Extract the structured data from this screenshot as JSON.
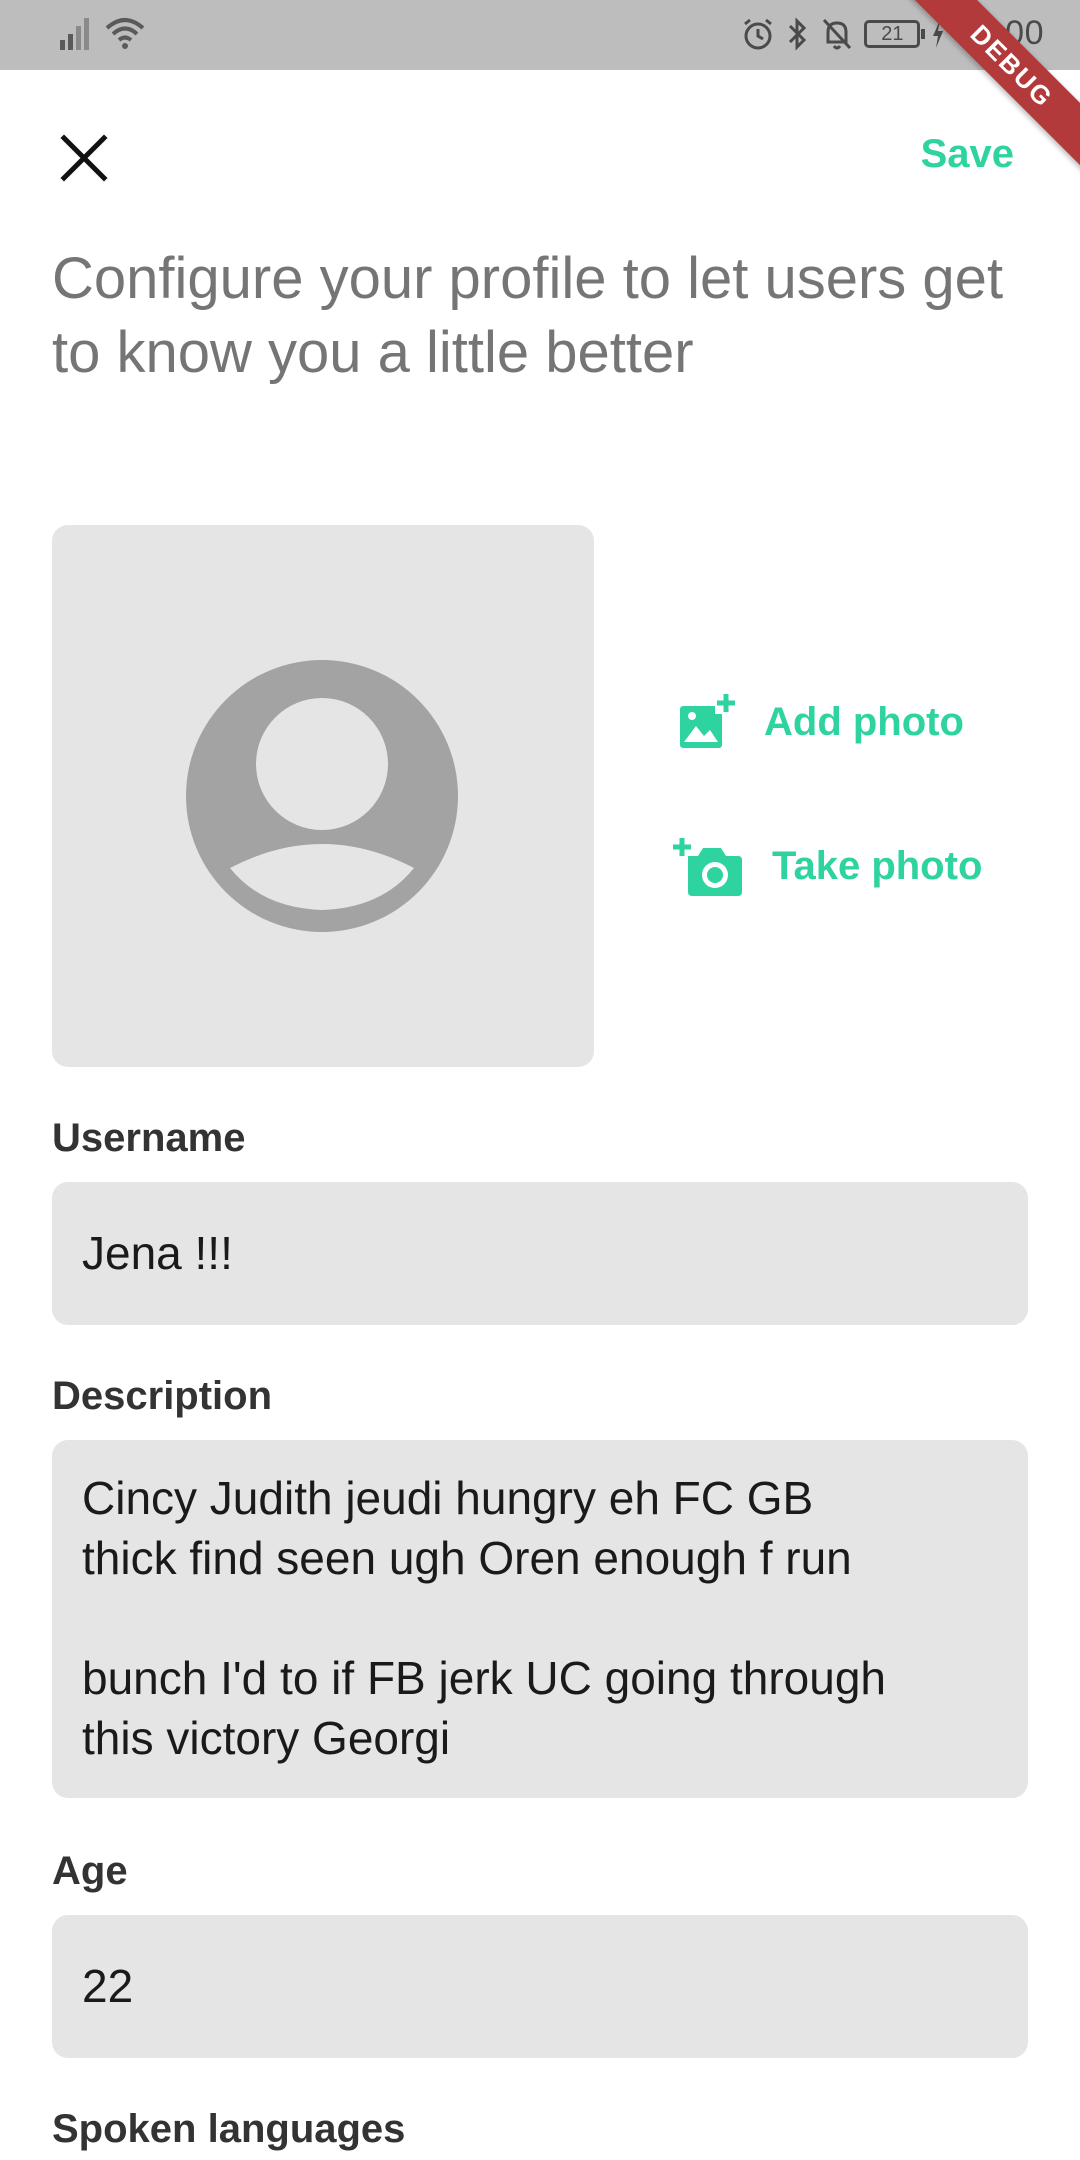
{
  "status_bar": {
    "time": "14:00",
    "battery": "21"
  },
  "debug_banner": "DEBUG",
  "header": {
    "save_label": "Save"
  },
  "headline": "Configure your profile to let users get to know you a little better",
  "photo": {
    "add_label": "Add photo",
    "take_label": "Take photo"
  },
  "form": {
    "username_label": "Username",
    "username_value": "Jena !!!",
    "description_label": "Description",
    "description_line1": "Cincy Judith jeudi hungry eh FC GB",
    "description_line2": "thick find seen ugh Oren enough f run",
    "description_line3": "bunch I'd to if FB jerk UC going through",
    "description_line4": "this victory Georgi",
    "age_label": "Age",
    "age_value": "22",
    "languages_label": "Spoken languages"
  },
  "colors": {
    "accent": "#2ed3a0",
    "status_bar": "#bdbdbd",
    "field_bg": "#e5e5e5",
    "debug": "#b33a3a"
  }
}
